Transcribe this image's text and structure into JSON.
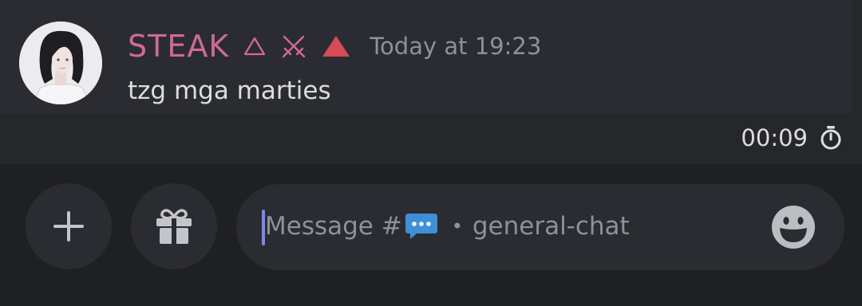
{
  "message": {
    "username": "STEAK",
    "badges": [
      "outline-triangle-icon",
      "crossed-swords-icon",
      "filled-triangle-icon"
    ],
    "timestamp": "Today at 19:23",
    "text": "tzg mga marties"
  },
  "timer": {
    "value": "00:09",
    "icon": "stopwatch-icon"
  },
  "composer": {
    "placeholder_prefix": "Message #",
    "channel_icon": "speech-bubble-icon",
    "separator": "•",
    "channel_name": "general-chat",
    "buttons": [
      "plus-icon",
      "gift-icon",
      "emoji-icon"
    ]
  },
  "colors": {
    "username": "#cf6a95",
    "accent_caret": "#7e86e8",
    "bubble": "#3f8fd8"
  }
}
